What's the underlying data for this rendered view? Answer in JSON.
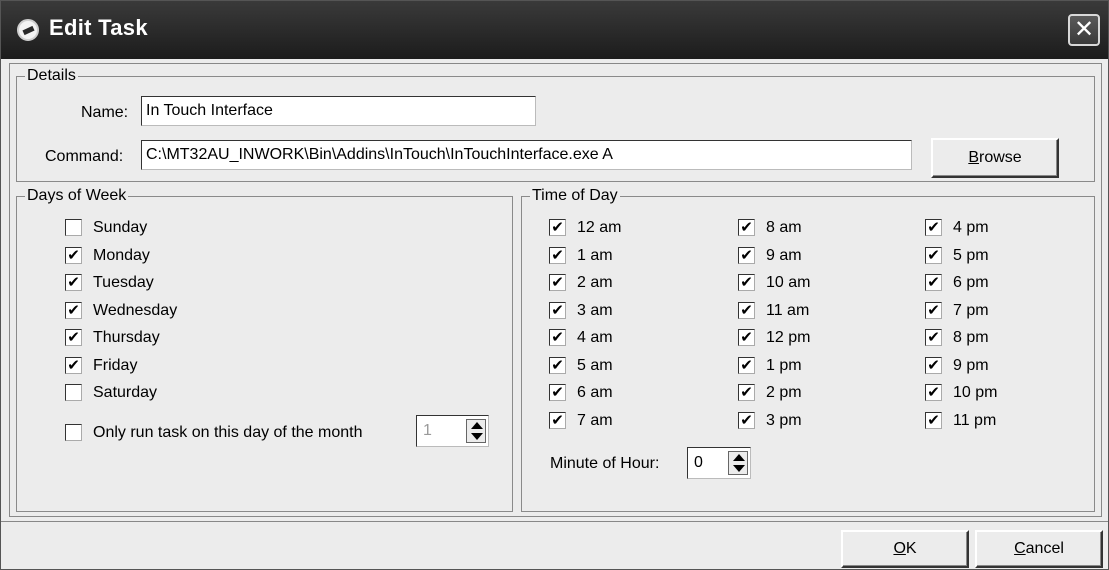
{
  "window": {
    "title": "Edit Task",
    "close_glyph": "✕"
  },
  "details": {
    "legend": "Details",
    "name_label": "Name:",
    "name_value": "In Touch Interface",
    "command_label": "Command:",
    "command_value": "C:\\MT32AU_INWORK\\Bin\\Addins\\InTouch\\InTouchInterface.exe A",
    "browse_first": "B",
    "browse_rest": "rowse"
  },
  "days": {
    "legend": "Days of Week",
    "items": [
      {
        "label": "Sunday",
        "mark": ""
      },
      {
        "label": "Monday",
        "mark": "✔"
      },
      {
        "label": "Tuesday",
        "mark": "✔"
      },
      {
        "label": "Wednesday",
        "mark": "✔"
      },
      {
        "label": "Thursday",
        "mark": "✔"
      },
      {
        "label": "Friday",
        "mark": "✔"
      },
      {
        "label": "Saturday",
        "mark": ""
      }
    ],
    "only_run_label": "Only run task on this day of the month",
    "only_run_mark": "",
    "day_of_month": "1"
  },
  "time": {
    "legend": "Time of Day",
    "hours": [
      {
        "label": "12 am",
        "mark": "✔"
      },
      {
        "label": "1 am",
        "mark": "✔"
      },
      {
        "label": "2 am",
        "mark": "✔"
      },
      {
        "label": "3 am",
        "mark": "✔"
      },
      {
        "label": "4 am",
        "mark": "✔"
      },
      {
        "label": "5 am",
        "mark": "✔"
      },
      {
        "label": "6 am",
        "mark": "✔"
      },
      {
        "label": "7 am",
        "mark": "✔"
      },
      {
        "label": "8 am",
        "mark": "✔"
      },
      {
        "label": "9 am",
        "mark": "✔"
      },
      {
        "label": "10 am",
        "mark": "✔"
      },
      {
        "label": "11 am",
        "mark": "✔"
      },
      {
        "label": "12 pm",
        "mark": "✔"
      },
      {
        "label": "1 pm",
        "mark": "✔"
      },
      {
        "label": "2 pm",
        "mark": "✔"
      },
      {
        "label": "3 pm",
        "mark": "✔"
      },
      {
        "label": "4 pm",
        "mark": "✔"
      },
      {
        "label": "5 pm",
        "mark": "✔"
      },
      {
        "label": "6 pm",
        "mark": "✔"
      },
      {
        "label": "7 pm",
        "mark": "✔"
      },
      {
        "label": "8 pm",
        "mark": "✔"
      },
      {
        "label": "9 pm",
        "mark": "✔"
      },
      {
        "label": "10 pm",
        "mark": "✔"
      },
      {
        "label": "11 pm",
        "mark": "✔"
      }
    ],
    "minute_label": "Minute of Hour:",
    "minute_value": "0"
  },
  "footer": {
    "ok_first": "O",
    "ok_rest": "K",
    "cancel_first": "C",
    "cancel_rest": "ancel"
  }
}
